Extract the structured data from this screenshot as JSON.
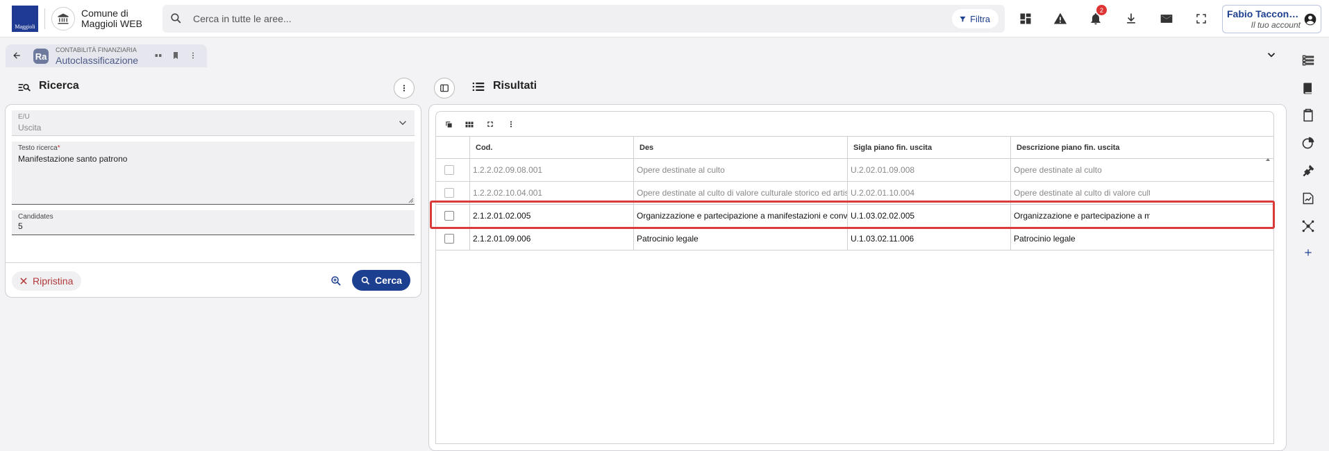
{
  "topbar": {
    "logo_text": "Maggioli",
    "org_name_line1": "Comune di",
    "org_name_line2": "Maggioli WEB",
    "search_placeholder": "Cerca in tutte le aree...",
    "filter_label": "Filtra",
    "notification_count": "2",
    "account_name": "Fabio Taccone...",
    "account_sub": "Il tuo account"
  },
  "tab": {
    "module": "CONTABILITÀ FINANZIARIA",
    "title": "Autoclassificazione",
    "app_icon_text": "Ra"
  },
  "search_panel": {
    "title": "Ricerca",
    "eu": {
      "label": "E/U",
      "value": "Uscita"
    },
    "testo": {
      "label": "Testo ricerca",
      "required_mark": "*",
      "value": "Manifestazione santo patrono"
    },
    "candidates": {
      "label": "Candidates",
      "value": "5"
    },
    "reset_label": "Ripristina",
    "search_label": "Cerca"
  },
  "results_panel": {
    "title": "Risultati",
    "columns": [
      "Cod.",
      "Des",
      "Sigla piano fin. uscita",
      "Descrizione piano fin. uscita"
    ],
    "rows": [
      {
        "cod": "1.2.2.02.09.08.001",
        "des": "Opere destinate al culto",
        "sigla": "U.2.02.01.09.008",
        "descr": "Opere destinate al culto"
      },
      {
        "cod": "1.2.2.02.10.04.001",
        "des": "Opere destinate al culto di valore culturale storico ed artistico",
        "sigla": "U.2.02.01.10.004",
        "descr": "Opere destinate al culto di valore culturale storico ed artistico"
      },
      {
        "cod": "2.1.2.01.02.005",
        "des": "Organizzazione e partecipazione a manifestazioni e convegni",
        "sigla": "U.1.03.02.02.005",
        "descr": "Organizzazione e partecipazione a manifestazioni e convegni"
      },
      {
        "cod": "2.1.2.01.09.006",
        "des": "Patrocinio legale",
        "sigla": "U.1.03.02.11.006",
        "descr": "Patrocinio legale"
      }
    ]
  },
  "colors": {
    "brand_blue": "#1d3f8f",
    "highlight_red": "#d93a3a",
    "reset_red": "#b23a3a"
  }
}
